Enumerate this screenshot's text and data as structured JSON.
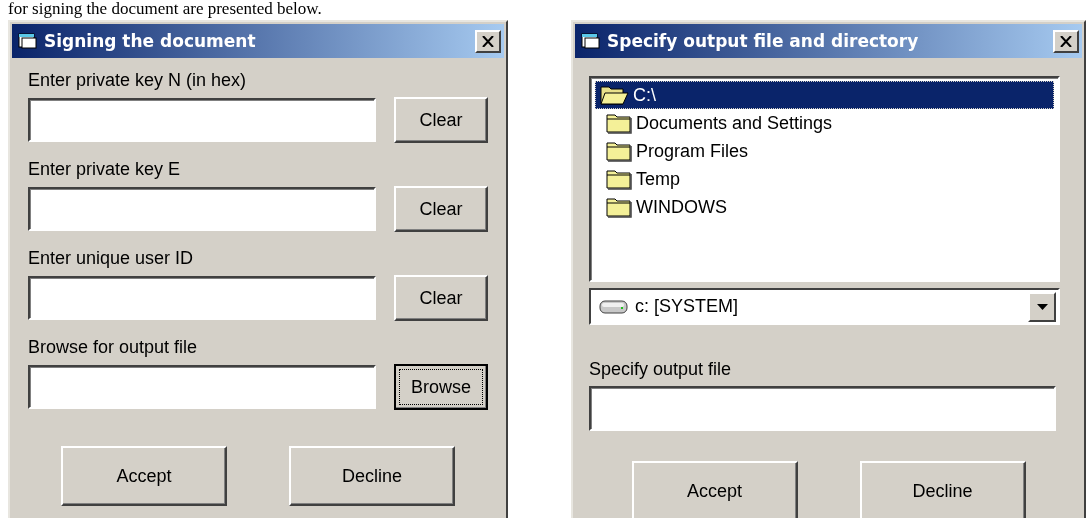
{
  "intro_text": "for signing the document are presented below.",
  "signing_dialog": {
    "title": "Signing the document",
    "fields": [
      {
        "label": "Enter private key N (in hex)",
        "button": {
          "label": "Clear",
          "focused": false
        }
      },
      {
        "label": "Enter private key E",
        "button": {
          "label": "Clear",
          "focused": false
        }
      },
      {
        "label": "Enter unique user ID",
        "button": {
          "label": "Clear",
          "focused": false
        }
      },
      {
        "label": "Browse for output file",
        "button": {
          "label": "Browse",
          "focused": true
        }
      }
    ],
    "buttons": [
      "Accept",
      "Decline"
    ]
  },
  "output_dialog": {
    "title": "Specify output file and directory",
    "folders": [
      {
        "name": "C:\\",
        "selected": true,
        "expanded": true
      },
      {
        "name": "Documents and Settings",
        "selected": false,
        "expanded": false
      },
      {
        "name": "Program Files",
        "selected": false,
        "expanded": false
      },
      {
        "name": "Temp",
        "selected": false,
        "expanded": false
      },
      {
        "name": "WINDOWS",
        "selected": false,
        "expanded": false
      }
    ],
    "drive": "c: [SYSTEM]",
    "file_label": "Specify output file",
    "buttons": [
      "Accept",
      "Decline"
    ]
  }
}
